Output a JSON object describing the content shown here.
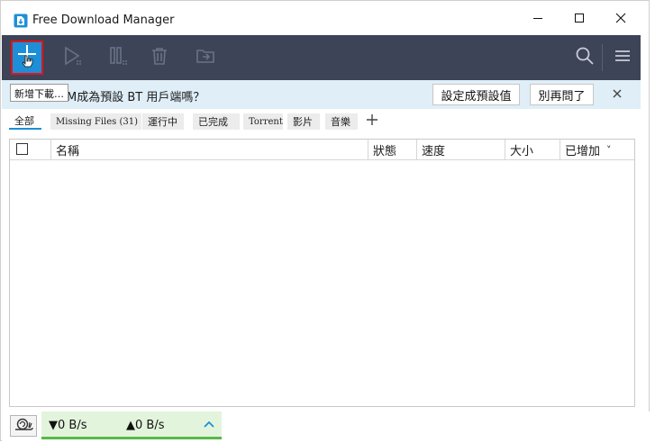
{
  "window": {
    "title": "Free Download Manager"
  },
  "toolbar": {
    "add_tooltip": "新增下載…",
    "icons": [
      "plus-icon",
      "play-icon",
      "pause-icon",
      "trash-icon",
      "move-folder-icon",
      "search-icon",
      "menu-icon"
    ]
  },
  "notice": {
    "text": "M成為預設 BT 用戶端嗎？",
    "set_default_label": "設定成預設值",
    "dont_ask_label": "別再問了"
  },
  "tabs": [
    {
      "label": "全部",
      "active": true
    },
    {
      "label": "Missing Files (31)"
    },
    {
      "label": "運行中"
    },
    {
      "label": "已完成"
    },
    {
      "label": "Torrent"
    },
    {
      "label": "影片"
    },
    {
      "label": "音樂"
    }
  ],
  "table": {
    "columns": [
      "名稱",
      "狀態",
      "速度",
      "大小",
      "已增加"
    ],
    "sort_indicator": "˅",
    "rows": []
  },
  "status": {
    "download_speed": "▼0 B/s",
    "upload_speed": "▲0 B/s"
  },
  "colors": {
    "toolbar_bg": "#3d4457",
    "accent": "#1c8fd8",
    "highlight_box": "#e2141b",
    "notice_bg": "#dfeef7",
    "speed_panel_bg": "#e3f4dd",
    "speed_panel_border": "#57b947"
  }
}
